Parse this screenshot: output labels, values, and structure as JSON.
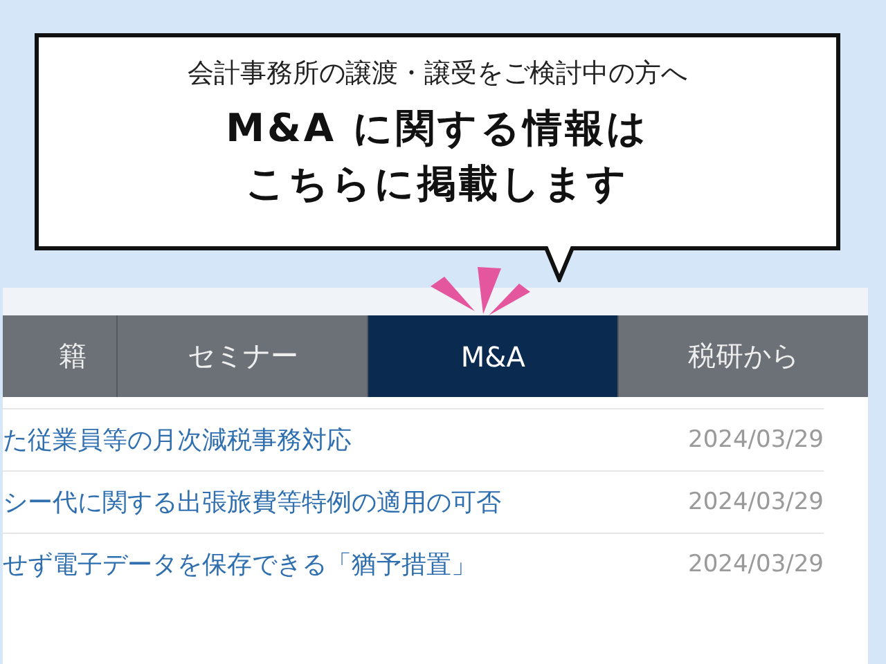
{
  "banner": {
    "subtitle": "会計事務所の譲渡・譲受をご検討中の方へ",
    "headline": [
      "M&A に関する情報は",
      "こちらに掲載します"
    ]
  },
  "tabs": [
    {
      "label": "籍",
      "selected": false
    },
    {
      "label": "セミナー",
      "selected": false
    },
    {
      "label": "M&A",
      "selected": true
    },
    {
      "label": "税研から",
      "selected": false
    }
  ],
  "articles": [
    {
      "title": "た従業員等の月次減税事務対応",
      "date": "2024/03/29"
    },
    {
      "title": "シー代に関する出張旅費等特例の適用の可否",
      "date": "2024/03/29"
    },
    {
      "title": "せず電子データを保存できる「猶予措置」",
      "date": "2024/03/29"
    }
  ]
}
